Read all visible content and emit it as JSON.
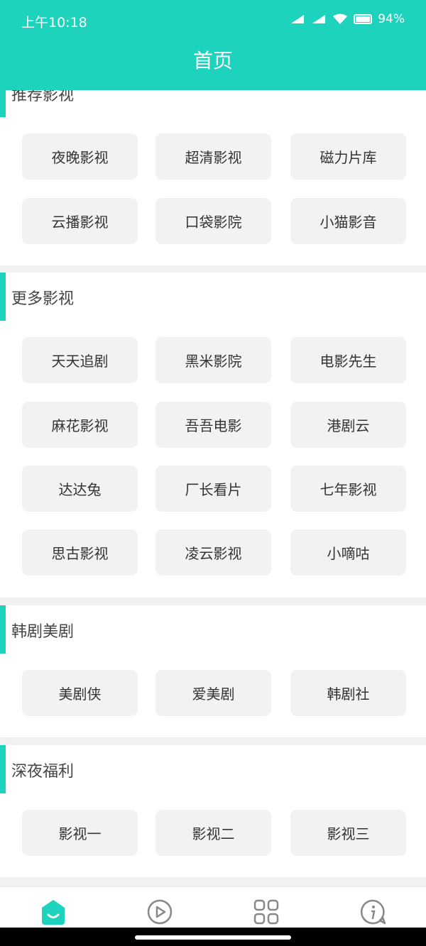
{
  "status_bar": {
    "time": "上午10:18",
    "battery": "94%"
  },
  "header": {
    "title": "首页"
  },
  "sections": [
    {
      "title": "推荐影视",
      "items": [
        "夜晚影视",
        "超清影视",
        "磁力片库",
        "云播影视",
        "口袋影院",
        "小猫影音"
      ]
    },
    {
      "title": "更多影视",
      "items": [
        "天天追剧",
        "黑米影院",
        "电影先生",
        "麻花影视",
        "吾吾电影",
        "港剧云",
        "达达兔",
        "厂长看片",
        "七年影视",
        "思古影视",
        "凌云影视",
        "小嘀咕"
      ]
    },
    {
      "title": "韩剧美剧",
      "items": [
        "美剧侠",
        "爱美剧",
        "韩剧社"
      ]
    },
    {
      "title": "深夜福利",
      "items": [
        "影视一",
        "影视二",
        "影视三"
      ]
    }
  ],
  "tabbar": {
    "accent": "#1dd3bd",
    "inactive": "#888888",
    "tabs": [
      "home-icon",
      "play-icon",
      "grid-icon",
      "info-icon"
    ]
  }
}
